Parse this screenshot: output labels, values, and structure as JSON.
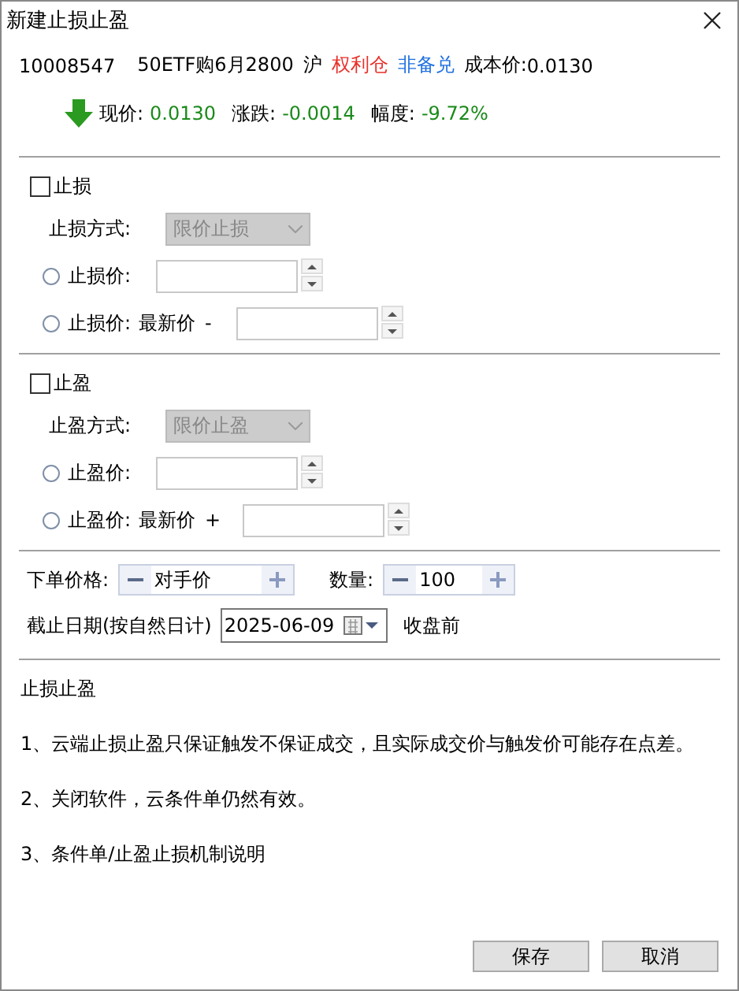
{
  "window": {
    "title": "新建止损止盈"
  },
  "contract": {
    "code": "10008547",
    "name": "50ETF购6月2800",
    "exchange": "沪",
    "position_type": "权利仓",
    "cover_type": "非备兑",
    "cost_label": "成本价:",
    "cost": "0.0130"
  },
  "quote": {
    "falling": true,
    "price_label": "现价:",
    "price": "0.0130",
    "change_label": "涨跌:",
    "change": "-0.0014",
    "pct_label": "幅度:",
    "pct": "-9.72%"
  },
  "sections": [
    {
      "label": "止损",
      "checked": false,
      "mode_label": "止损方式:",
      "mode": "限价止损",
      "mode_disabled": true,
      "options": [
        {
          "kind": "price",
          "label": "止损价:",
          "selected": false
        },
        {
          "kind": "offset",
          "label": "止损价:",
          "base": "最新价",
          "sign": "-",
          "selected": false
        }
      ]
    },
    {
      "label": "止盈",
      "checked": false,
      "mode_label": "止盈方式:",
      "mode": "限价止盈",
      "mode_disabled": true,
      "options": [
        {
          "kind": "price",
          "label": "止盈价:",
          "selected": false
        },
        {
          "kind": "offset",
          "label": "止盈价:",
          "base": "最新价",
          "sign": "+",
          "selected": false
        }
      ]
    }
  ],
  "order": {
    "price_label": "下单价格:",
    "price_value": "对手价",
    "qty_label": "数量:",
    "qty_value": "100"
  },
  "expiry": {
    "label": "截止日期(按自然日计)",
    "date": "2025-06-09",
    "suffix": "收盘前"
  },
  "notes": {
    "title": "止损止盈",
    "items": [
      "1、云端止损止盈只保证触发不保证成交，且实际成交价与触发价可能存在点差。",
      "2、关闭软件，云条件单仍然有效。",
      "3、条件单/止盈止损机制说明"
    ]
  },
  "buttons": [
    "保存",
    "取消"
  ]
}
